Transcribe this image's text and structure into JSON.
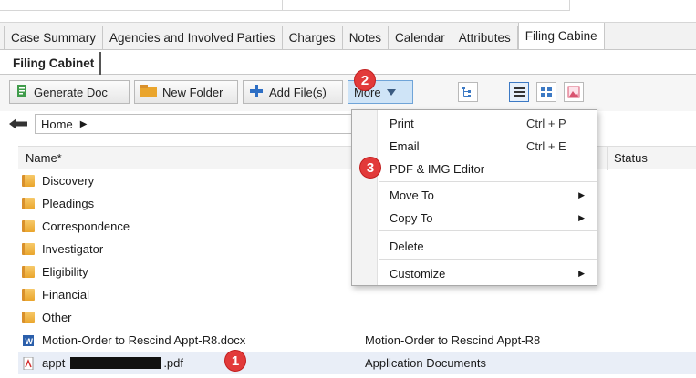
{
  "main_tabs": [
    "Case Summary",
    "Agencies and Involved Parties",
    "Charges",
    "Notes",
    "Calendar",
    "Attributes",
    "Filing Cabine"
  ],
  "sub_tab": "Filing Cabinet",
  "toolbar": {
    "generate_doc": "Generate Doc",
    "new_folder": "New Folder",
    "add_files": "Add File(s)",
    "more": "More"
  },
  "breadcrumb": {
    "home": "Home"
  },
  "grid": {
    "col_name": "Name*",
    "col_status": "Status",
    "folders": [
      "Discovery",
      "Pleadings",
      "Correspondence",
      "Investigator",
      "Eligibility",
      "Financial",
      "Other"
    ],
    "files": [
      {
        "name": "Motion-Order to Rescind Appt-R8.docx",
        "desc": "Motion-Order to Rescind Appt-R8"
      },
      {
        "name_prefix": "appt",
        "name_suffix": ".pdf",
        "desc": "Application Documents"
      }
    ]
  },
  "menu": {
    "print": "Print",
    "print_sc": "Ctrl + P",
    "email": "Email",
    "email_sc": "Ctrl + E",
    "pdf_editor": "PDF & IMG Editor",
    "move_to": "Move To",
    "copy_to": "Copy To",
    "delete": "Delete",
    "customize": "Customize"
  },
  "badges": {
    "one": "1",
    "two": "2",
    "three": "3"
  },
  "colors": {
    "badge": "#e23a3a",
    "more_bg": "#cfe4f7",
    "folder": "#eaa52c"
  }
}
